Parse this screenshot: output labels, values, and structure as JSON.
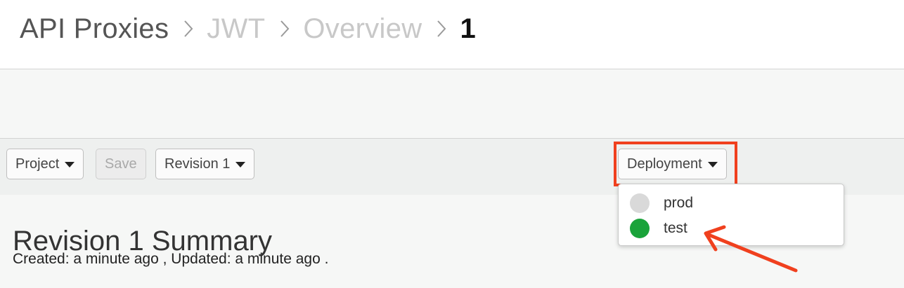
{
  "breadcrumb": {
    "items": [
      "API Proxies",
      "JWT",
      "Overview",
      "1"
    ]
  },
  "toolbar": {
    "project_label": "Project",
    "save_label": "Save",
    "revision_label": "Revision 1",
    "deployment_label": "Deployment"
  },
  "deployment_menu": {
    "items": [
      {
        "label": "prod",
        "status_color": "#d9d9d9"
      },
      {
        "label": "test",
        "status_color": "#1aa33a"
      }
    ]
  },
  "summary": {
    "title": "Revision 1 Summary",
    "meta": "Created: a minute ago , Updated: a minute ago ."
  },
  "annotation": {
    "color": "#f0401e"
  }
}
